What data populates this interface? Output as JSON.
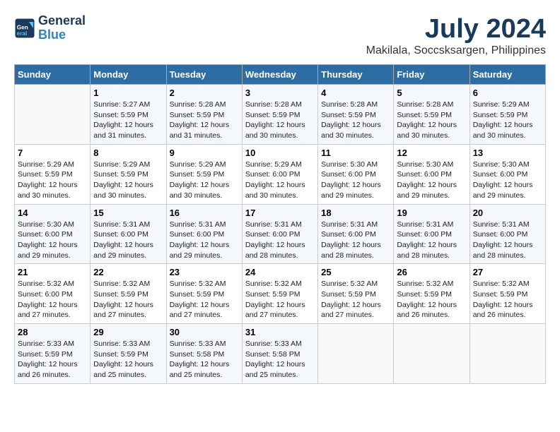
{
  "header": {
    "logo_line1": "General",
    "logo_line2": "Blue",
    "title": "July 2024",
    "subtitle": "Makilala, Soccsksargen, Philippines"
  },
  "days_of_week": [
    "Sunday",
    "Monday",
    "Tuesday",
    "Wednesday",
    "Thursday",
    "Friday",
    "Saturday"
  ],
  "weeks": [
    [
      {
        "day": "",
        "content": ""
      },
      {
        "day": "1",
        "content": "Sunrise: 5:27 AM\nSunset: 5:59 PM\nDaylight: 12 hours\nand 31 minutes."
      },
      {
        "day": "2",
        "content": "Sunrise: 5:28 AM\nSunset: 5:59 PM\nDaylight: 12 hours\nand 31 minutes."
      },
      {
        "day": "3",
        "content": "Sunrise: 5:28 AM\nSunset: 5:59 PM\nDaylight: 12 hours\nand 30 minutes."
      },
      {
        "day": "4",
        "content": "Sunrise: 5:28 AM\nSunset: 5:59 PM\nDaylight: 12 hours\nand 30 minutes."
      },
      {
        "day": "5",
        "content": "Sunrise: 5:28 AM\nSunset: 5:59 PM\nDaylight: 12 hours\nand 30 minutes."
      },
      {
        "day": "6",
        "content": "Sunrise: 5:29 AM\nSunset: 5:59 PM\nDaylight: 12 hours\nand 30 minutes."
      }
    ],
    [
      {
        "day": "7",
        "content": "Sunrise: 5:29 AM\nSunset: 5:59 PM\nDaylight: 12 hours\nand 30 minutes."
      },
      {
        "day": "8",
        "content": "Sunrise: 5:29 AM\nSunset: 5:59 PM\nDaylight: 12 hours\nand 30 minutes."
      },
      {
        "day": "9",
        "content": "Sunrise: 5:29 AM\nSunset: 5:59 PM\nDaylight: 12 hours\nand 30 minutes."
      },
      {
        "day": "10",
        "content": "Sunrise: 5:29 AM\nSunset: 6:00 PM\nDaylight: 12 hours\nand 30 minutes."
      },
      {
        "day": "11",
        "content": "Sunrise: 5:30 AM\nSunset: 6:00 PM\nDaylight: 12 hours\nand 29 minutes."
      },
      {
        "day": "12",
        "content": "Sunrise: 5:30 AM\nSunset: 6:00 PM\nDaylight: 12 hours\nand 29 minutes."
      },
      {
        "day": "13",
        "content": "Sunrise: 5:30 AM\nSunset: 6:00 PM\nDaylight: 12 hours\nand 29 minutes."
      }
    ],
    [
      {
        "day": "14",
        "content": "Sunrise: 5:30 AM\nSunset: 6:00 PM\nDaylight: 12 hours\nand 29 minutes."
      },
      {
        "day": "15",
        "content": "Sunrise: 5:31 AM\nSunset: 6:00 PM\nDaylight: 12 hours\nand 29 minutes."
      },
      {
        "day": "16",
        "content": "Sunrise: 5:31 AM\nSunset: 6:00 PM\nDaylight: 12 hours\nand 29 minutes."
      },
      {
        "day": "17",
        "content": "Sunrise: 5:31 AM\nSunset: 6:00 PM\nDaylight: 12 hours\nand 28 minutes."
      },
      {
        "day": "18",
        "content": "Sunrise: 5:31 AM\nSunset: 6:00 PM\nDaylight: 12 hours\nand 28 minutes."
      },
      {
        "day": "19",
        "content": "Sunrise: 5:31 AM\nSunset: 6:00 PM\nDaylight: 12 hours\nand 28 minutes."
      },
      {
        "day": "20",
        "content": "Sunrise: 5:31 AM\nSunset: 6:00 PM\nDaylight: 12 hours\nand 28 minutes."
      }
    ],
    [
      {
        "day": "21",
        "content": "Sunrise: 5:32 AM\nSunset: 6:00 PM\nDaylight: 12 hours\nand 27 minutes."
      },
      {
        "day": "22",
        "content": "Sunrise: 5:32 AM\nSunset: 5:59 PM\nDaylight: 12 hours\nand 27 minutes."
      },
      {
        "day": "23",
        "content": "Sunrise: 5:32 AM\nSunset: 5:59 PM\nDaylight: 12 hours\nand 27 minutes."
      },
      {
        "day": "24",
        "content": "Sunrise: 5:32 AM\nSunset: 5:59 PM\nDaylight: 12 hours\nand 27 minutes."
      },
      {
        "day": "25",
        "content": "Sunrise: 5:32 AM\nSunset: 5:59 PM\nDaylight: 12 hours\nand 27 minutes."
      },
      {
        "day": "26",
        "content": "Sunrise: 5:32 AM\nSunset: 5:59 PM\nDaylight: 12 hours\nand 26 minutes."
      },
      {
        "day": "27",
        "content": "Sunrise: 5:32 AM\nSunset: 5:59 PM\nDaylight: 12 hours\nand 26 minutes."
      }
    ],
    [
      {
        "day": "28",
        "content": "Sunrise: 5:33 AM\nSunset: 5:59 PM\nDaylight: 12 hours\nand 26 minutes."
      },
      {
        "day": "29",
        "content": "Sunrise: 5:33 AM\nSunset: 5:59 PM\nDaylight: 12 hours\nand 25 minutes."
      },
      {
        "day": "30",
        "content": "Sunrise: 5:33 AM\nSunset: 5:58 PM\nDaylight: 12 hours\nand 25 minutes."
      },
      {
        "day": "31",
        "content": "Sunrise: 5:33 AM\nSunset: 5:58 PM\nDaylight: 12 hours\nand 25 minutes."
      },
      {
        "day": "",
        "content": ""
      },
      {
        "day": "",
        "content": ""
      },
      {
        "day": "",
        "content": ""
      }
    ]
  ]
}
